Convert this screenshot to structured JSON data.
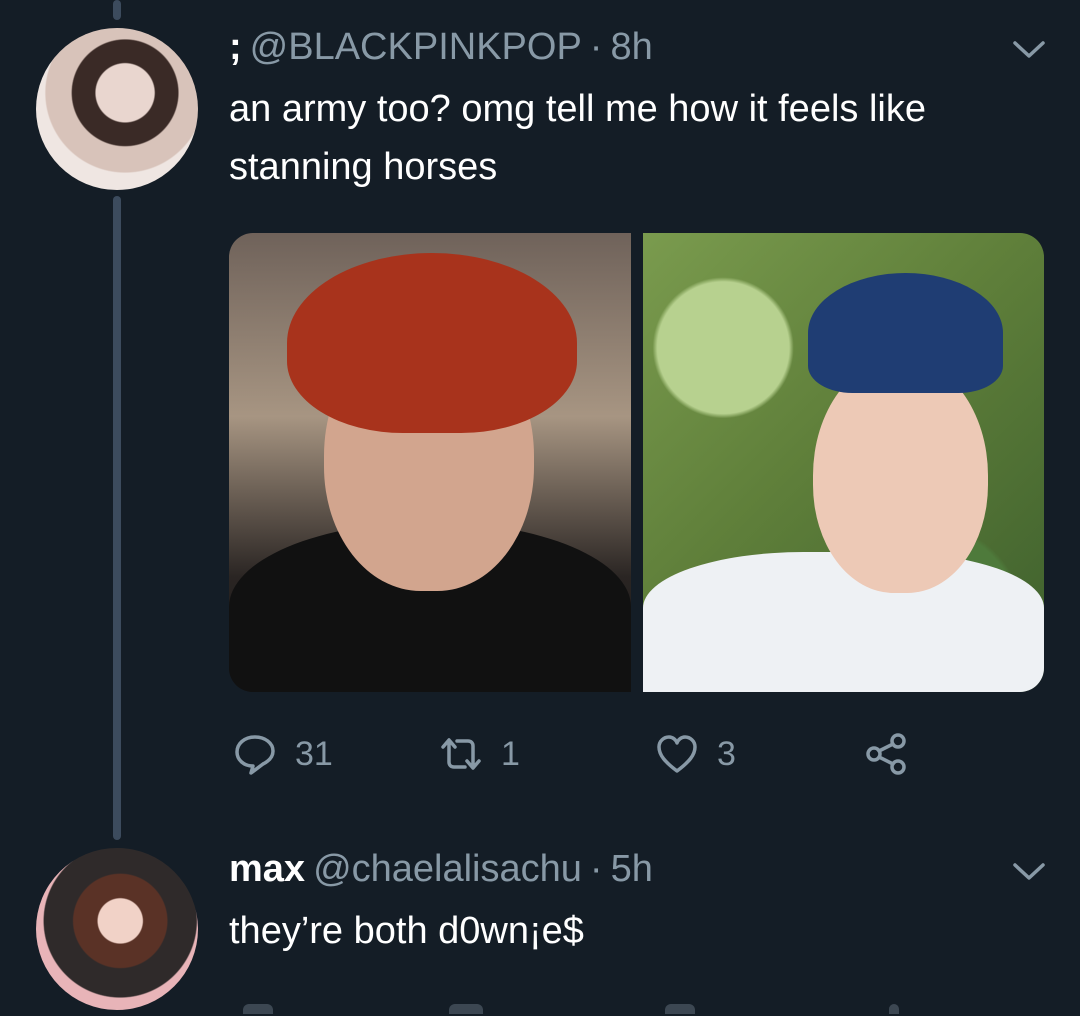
{
  "tweet1": {
    "display_name": ";",
    "handle": "@BLACKPINKPOP",
    "separator": "·",
    "time": "8h",
    "text": "an army too? omg tell me how it feels like stanning horses",
    "actions": {
      "replies": "31",
      "retweets": "1",
      "likes": "3"
    },
    "icons": [
      "reply-icon",
      "retweet-icon",
      "like-icon",
      "share-icon",
      "chevron-down-icon"
    ]
  },
  "tweet2": {
    "display_name": "max",
    "handle": "@chaelalisachu",
    "separator": "·",
    "time": "5h",
    "text": "they’re both d0wn¡e$"
  },
  "colors": {
    "background": "#141d26",
    "secondary_text": "#8899a6",
    "thread_line": "#3c4b5d",
    "primary_text": "#ffffff"
  }
}
